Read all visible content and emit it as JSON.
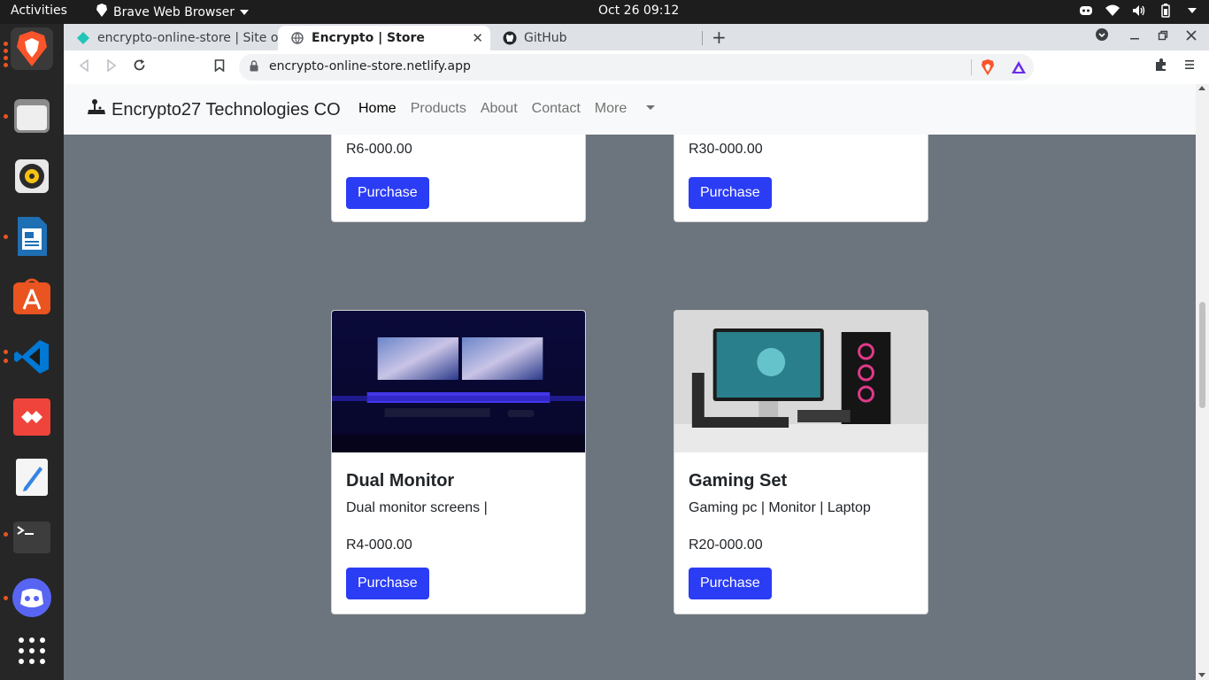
{
  "system": {
    "activities": "Activities",
    "app_menu": "Brave Web Browser",
    "clock": "Oct 26  09:12"
  },
  "dock": {
    "items": [
      "brave-browser",
      "files",
      "rhythmbox",
      "libreoffice-writer",
      "app-center",
      "vscode",
      "anydesk",
      "text-editor",
      "terminal",
      "discord",
      "show-apps"
    ]
  },
  "browser": {
    "tabs": [
      {
        "label": "encrypto-online-store | Site ov"
      },
      {
        "label": "Encrypto | Store"
      },
      {
        "label": "GitHub"
      }
    ],
    "url": "encrypto-online-store.netlify.app"
  },
  "site": {
    "brand": "Encrypto27 Technologies CO",
    "nav": {
      "home": "Home",
      "products": "Products",
      "about": "About",
      "contact": "Contact",
      "more": "More"
    },
    "cards_top": [
      {
        "price": "R6-000.00",
        "button": "Purchase"
      },
      {
        "price": "R30-000.00",
        "button": "Purchase"
      }
    ],
    "cards": [
      {
        "title": "Dual Monitor",
        "text": "Dual monitor screens |",
        "price": "R4-000.00",
        "button": "Purchase"
      },
      {
        "title": "Gaming Set",
        "text": "Gaming pc | Monitor | Laptop",
        "price": "R20-000.00",
        "button": "Purchase"
      }
    ]
  },
  "colors": {
    "page_bg": "#6c757d",
    "button": "#2b3cf5",
    "navbar": "#f8f9fa"
  }
}
